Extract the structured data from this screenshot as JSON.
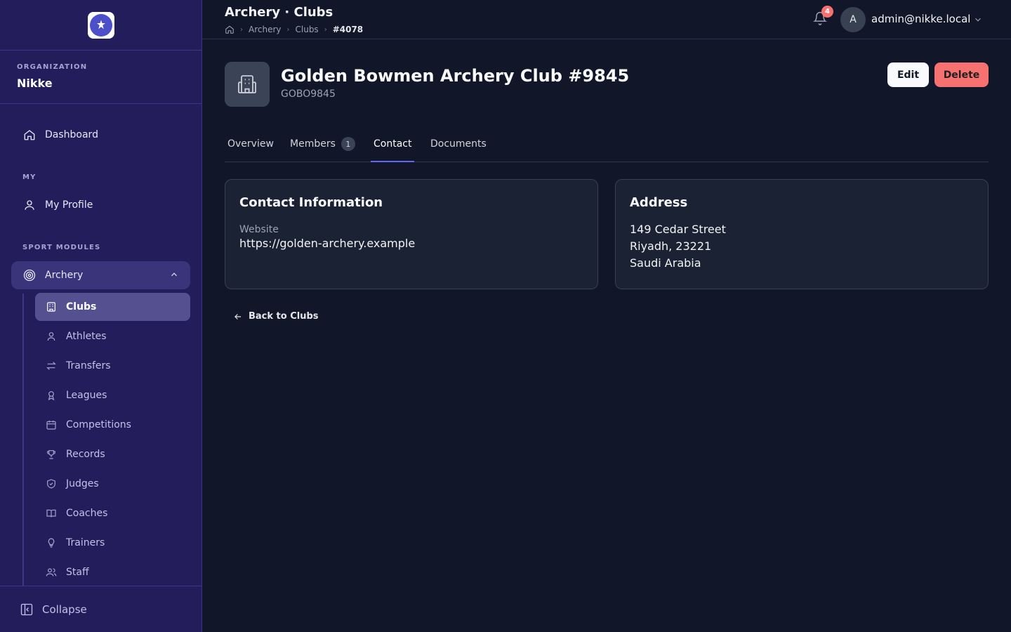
{
  "sidebar": {
    "org_label": "ORGANIZATION",
    "org_name": "Nikke",
    "dashboard": "Dashboard",
    "my_label": "MY",
    "my_profile": "My Profile",
    "sport_label": "SPORT MODULES",
    "archery": "Archery",
    "sub_items": [
      "Clubs",
      "Athletes",
      "Transfers",
      "Leagues",
      "Competitions",
      "Records",
      "Judges",
      "Coaches",
      "Trainers",
      "Staff"
    ],
    "collapse": "Collapse"
  },
  "header": {
    "title": "Archery · Clubs",
    "breadcrumb": [
      "Archery",
      "Clubs",
      "#4078"
    ],
    "notifications": "4",
    "avatar_initial": "A",
    "user_email": "admin@nikke.local"
  },
  "club": {
    "name": "Golden Bowmen Archery Club #9845",
    "code": "GOBO9845",
    "edit_label": "Edit",
    "delete_label": "Delete"
  },
  "tabs": [
    {
      "label": "Overview"
    },
    {
      "label": "Members",
      "count": "1"
    },
    {
      "label": "Contact",
      "active": true
    },
    {
      "label": "Documents"
    }
  ],
  "contact": {
    "title": "Contact Information",
    "website_label": "Website",
    "website_value": "https://golden-archery.example"
  },
  "address": {
    "title": "Address",
    "lines": [
      "149 Cedar Street",
      "Riyadh, 23221",
      "Saudi Arabia"
    ]
  },
  "back_label": "Back to Clubs",
  "colors": {
    "sidebar_bg": "#231d5c",
    "main_bg": "#111729",
    "accent": "#6366f1",
    "danger": "#f87171"
  }
}
